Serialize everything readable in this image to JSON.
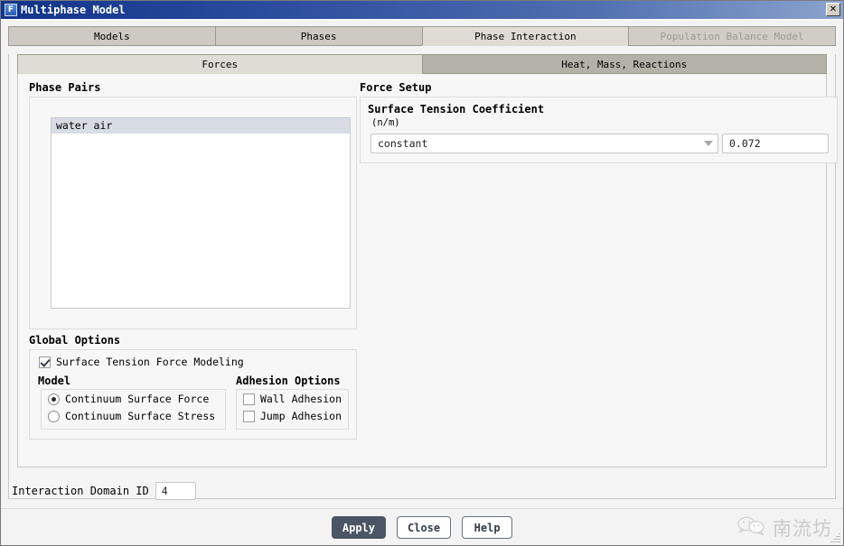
{
  "window": {
    "title": "Multiphase Model",
    "icon": "fluent-f-icon",
    "icon_letter": "F",
    "close_label": "✕",
    "titlebar_gradient_start": "#11348a",
    "titlebar_gradient_end": "#8ba4cd"
  },
  "tabs": [
    {
      "label": "Models",
      "state": "inactive"
    },
    {
      "label": "Phases",
      "state": "inactive"
    },
    {
      "label": "Phase Interaction",
      "state": "active"
    },
    {
      "label": "Population Balance Model",
      "state": "disabled"
    }
  ],
  "subtabs": [
    {
      "label": "Forces",
      "state": "active"
    },
    {
      "label": "Heat, Mass, Reactions",
      "state": "inactive"
    }
  ],
  "phase_pairs": {
    "group_label": "Phase Pairs",
    "items": [
      {
        "label": "water air",
        "selected": true
      }
    ]
  },
  "force_setup": {
    "group_label": "Force Setup",
    "field_title": "Surface Tension Coefficient",
    "units": "(n/m)",
    "method": "constant",
    "value": "0.072"
  },
  "global_options": {
    "group_label": "Global Options",
    "surface_tension_force_modeling": {
      "label": "Surface Tension Force Modeling",
      "checked": true
    },
    "model": {
      "group_label": "Model",
      "options": [
        {
          "label": "Continuum Surface Force",
          "selected": true
        },
        {
          "label": "Continuum Surface Stress",
          "selected": false
        }
      ]
    },
    "adhesion": {
      "group_label": "Adhesion Options",
      "options": [
        {
          "label": "Wall Adhesion",
          "checked": false
        },
        {
          "label": "Jump Adhesion",
          "checked": false
        }
      ]
    }
  },
  "interaction_domain": {
    "label": "Interaction Domain ID",
    "value": "4"
  },
  "footer": {
    "apply_label": "Apply",
    "close_label": "Close",
    "help_label": "Help",
    "apply_color": "#4b5565"
  },
  "watermark": {
    "icon": "wechat-icon",
    "text": "南流坊"
  }
}
